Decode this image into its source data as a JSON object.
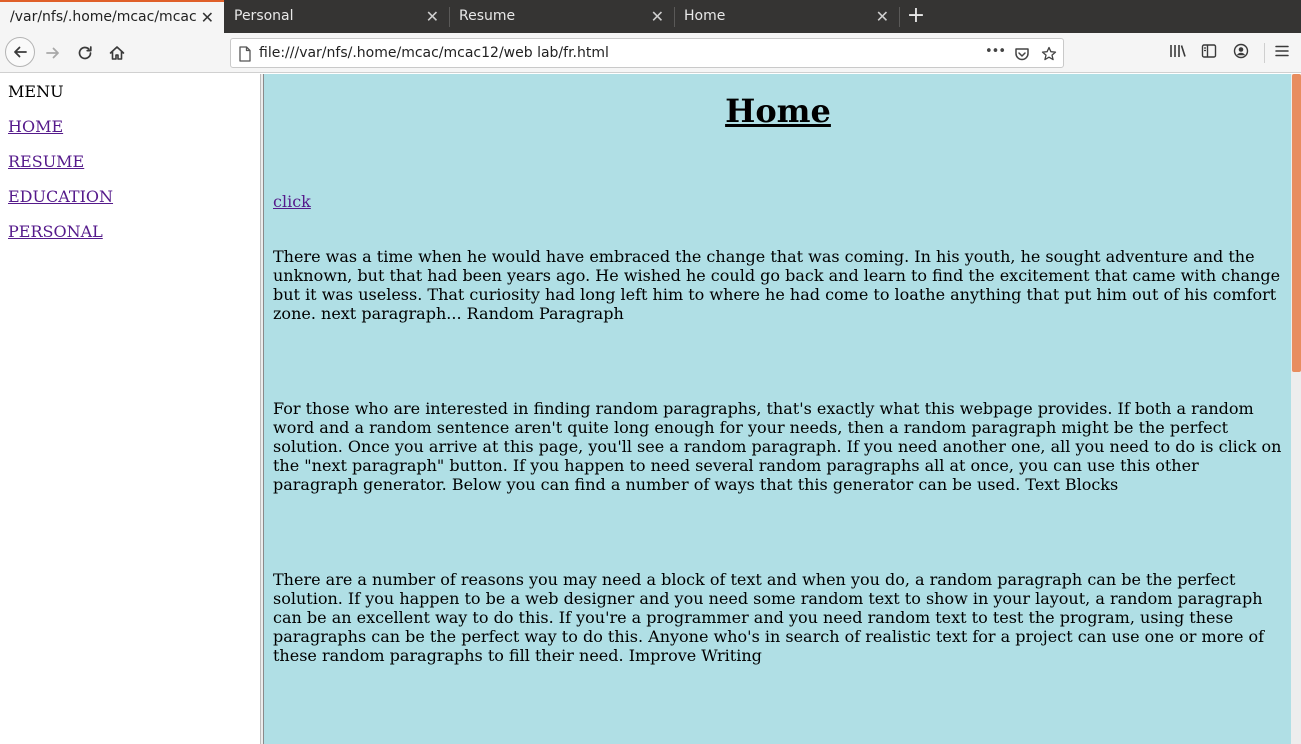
{
  "browser": {
    "tabs": [
      {
        "label": "/var/nfs/.home/mcac/mcac",
        "active": true
      },
      {
        "label": "Personal",
        "active": false
      },
      {
        "label": "Resume",
        "active": false
      },
      {
        "label": "Home",
        "active": false
      }
    ],
    "close_glyph": "✕",
    "new_tab_glyph": "+",
    "url": "file:///var/nfs/.home/mcac/mcac12/web lab/fr.html",
    "page_actions_glyph": "•••",
    "accent_color": "#e0602a"
  },
  "menu": {
    "title": "MENU",
    "links": [
      "HOME",
      "RESUME",
      "EDUCATION",
      "PERSONAL"
    ]
  },
  "content": {
    "heading": "Home",
    "click_label": "click",
    "background_color": "#b0dfe5",
    "paragraphs": [
      "There was a time when he would have embraced the change that was coming. In his youth, he sought adventure and the unknown, but that had been years ago. He wished he could go back and learn to find the excitement that came with change but it was useless. That curiosity had long left him to where he had come to loathe anything that put him out of his comfort zone. next paragraph... Random Paragraph",
      "For those who are interested in finding random paragraphs, that's exactly what this webpage provides. If both a random word and a random sentence aren't quite long enough for your needs, then a random paragraph might be the perfect solution. Once you arrive at this page, you'll see a random paragraph. If you need another one, all you need to do is click on the \"next paragraph\" button. If you happen to need several random paragraphs all at once, you can use this other paragraph generator. Below you can find a number of ways that this generator can be used. Text Blocks",
      "There are a number of reasons you may need a block of text and when you do, a random paragraph can be the perfect solution. If you happen to be a web designer and you need some random text to show in your layout, a random paragraph can be an excellent way to do this. If you're a programmer and you need random text to test the program, using these paragraphs can be the perfect way to do this. Anyone who's in search of realistic text for a project can use one or more of these random paragraphs to fill their need. Improve Writing"
    ]
  }
}
